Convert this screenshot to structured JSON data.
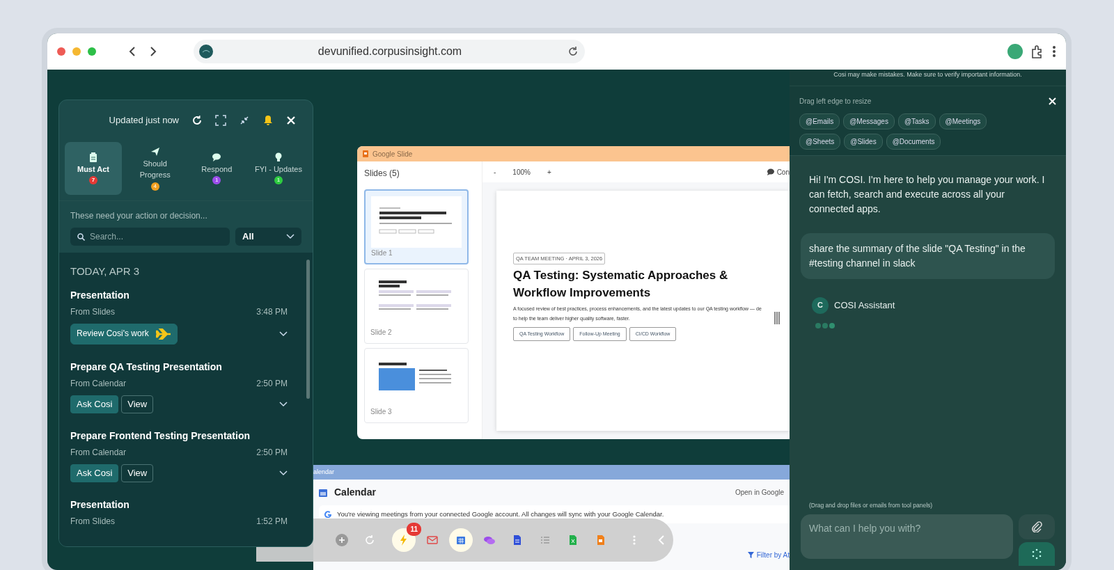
{
  "browser": {
    "url": "devunified.corpusinsight.com"
  },
  "task_panel": {
    "status": "Updated just now",
    "tabs": [
      {
        "label": "Must Act",
        "count": "7",
        "color": "#e53935",
        "kind": "clipboard",
        "selected": true
      },
      {
        "label": "Should Progress",
        "count": "4",
        "color": "#f0a020",
        "kind": "plane",
        "selected": false
      },
      {
        "label": "Respond",
        "count": "1",
        "color": "#9b4dea",
        "kind": "chat",
        "selected": false
      },
      {
        "label": "FYI - Updates",
        "count": "1",
        "color": "#2ecc40",
        "kind": "bulb",
        "selected": false
      }
    ],
    "hint": "These need your action or decision...",
    "search": {
      "placeholder": "Search..."
    },
    "filter": "All",
    "date_heading": "TODAY, APR 3",
    "items": [
      {
        "title": "Presentation",
        "source": "From Slides",
        "time": "3:48 PM",
        "actions": [
          {
            "label": "Review Cosi's work",
            "kind": "review"
          }
        ]
      },
      {
        "title": "Prepare QA Testing Presentation",
        "source": "From Calendar",
        "time": "2:50 PM",
        "actions": [
          {
            "label": "Ask Cosi",
            "kind": "primary"
          },
          {
            "label": "View",
            "kind": "outline"
          }
        ]
      },
      {
        "title": "Prepare Frontend Testing Presentation",
        "source": "From Calendar",
        "time": "2:50 PM",
        "actions": [
          {
            "label": "Ask Cosi",
            "kind": "primary"
          },
          {
            "label": "View",
            "kind": "outline"
          }
        ]
      },
      {
        "title": "Presentation",
        "source": "From Slides",
        "time": "1:52 PM"
      }
    ]
  },
  "slides_window": {
    "title": "Google Slide",
    "list_title": "Slides (5)",
    "thumbnails": [
      {
        "label": "Slide 1",
        "kind": "title",
        "selected": true
      },
      {
        "label": "Slide 2",
        "kind": "grid",
        "selected": false
      },
      {
        "label": "Slide 3",
        "kind": "columns",
        "selected": false
      }
    ],
    "zoom": {
      "minus": "-",
      "level": "100%",
      "plus": "+"
    },
    "comments": "Con",
    "slide": {
      "tag": "QA TEAM MEETING · APRIL 3, 2026",
      "title": "QA Testing: Systematic Approaches & Workflow Improvements",
      "lines": [
        "A focused review of best practices, process enhancements, and the latest updates to our QA testing workflow — de",
        "to help the team deliver higher quality software, faster."
      ],
      "tags": [
        "QA Testing Workflow",
        "Follow-Up Meeting",
        "CI/CD Workflow"
      ]
    }
  },
  "calendar_window": {
    "title": "alendar",
    "heading": "Calendar",
    "open_link": "Open in Google",
    "notice": "You're viewing meetings from your connected Google account. All changes will sync with your Google Calendar.",
    "filter": "Filter by At"
  },
  "dock": {
    "items": [
      {
        "kind": "plus",
        "selected": false
      },
      {
        "kind": "refresh",
        "selected": false
      },
      {
        "kind": "bolt",
        "selected": true,
        "badge": "11"
      },
      {
        "kind": "mail",
        "selected": false
      },
      {
        "kind": "calendar",
        "selected": true
      },
      {
        "kind": "chat",
        "selected": false
      },
      {
        "kind": "doc",
        "selected": false
      },
      {
        "kind": "tasks",
        "selected": false
      },
      {
        "kind": "sheet",
        "selected": false
      },
      {
        "kind": "slides",
        "selected": false
      },
      {
        "kind": "more",
        "selected": false
      },
      {
        "kind": "back",
        "selected": false
      }
    ]
  },
  "chat_panel": {
    "disclaimer": "Cosi may make mistakes. Make sure to verify important information.",
    "resize_hint": "Drag left edge to resize",
    "mentions": [
      "@Emails",
      "@Messages",
      "@Tasks",
      "@Meetings",
      "@Sheets",
      "@Slides",
      "@Documents"
    ],
    "messages": [
      {
        "kind": "assistant",
        "text": "Hi! I'm COSI. I'm here to help you manage your work. I can fetch, search and execute across all your connected apps."
      },
      {
        "kind": "user",
        "text": "share the summary of the slide \"QA Testing\" in the #testing channel in slack"
      }
    ],
    "assistant": {
      "initial": "C",
      "name": "COSI Assistant"
    },
    "drop_hint": "(Drag and drop files or emails from tool panels)",
    "input": {
      "placeholder": "What can I help you with?"
    }
  }
}
